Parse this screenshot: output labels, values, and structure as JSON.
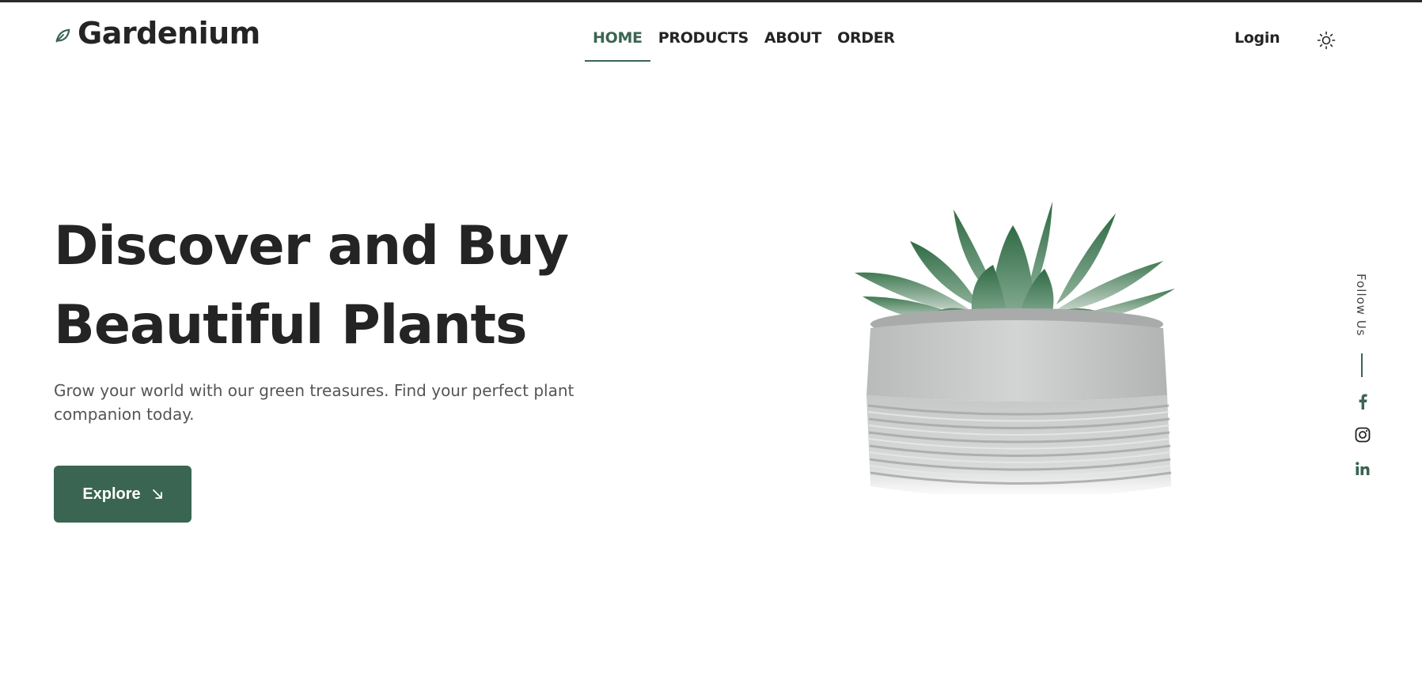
{
  "brand": {
    "name": "Gardenium",
    "icon": "leaf-icon",
    "accent": "#3a6552"
  },
  "nav": {
    "items": [
      {
        "label": "HOME",
        "active": true
      },
      {
        "label": "PRODUCTS",
        "active": false
      },
      {
        "label": "ABOUT",
        "active": false
      },
      {
        "label": "ORDER",
        "active": false
      }
    ]
  },
  "header": {
    "login_label": "Login",
    "theme_icon": "sun-icon"
  },
  "hero": {
    "title_line1": "Discover and Buy",
    "title_line2": "Beautiful Plants",
    "subtitle": "Grow your world with our green treasures. Find your perfect plant companion today.",
    "cta_label": "Explore",
    "cta_icon": "arrow-down-right-icon"
  },
  "social": {
    "follow_label": "Follow Us",
    "icons": [
      "facebook-icon",
      "instagram-icon",
      "linkedin-icon"
    ]
  }
}
